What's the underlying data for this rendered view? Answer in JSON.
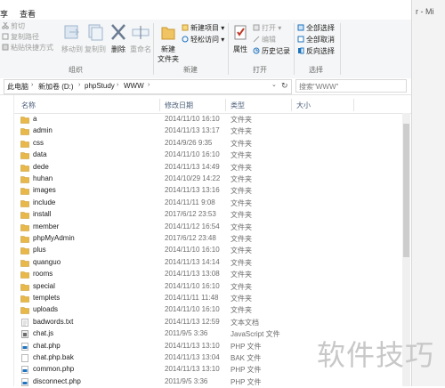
{
  "tabs": [
    "享",
    "查看"
  ],
  "window_fragment": "r - Mi",
  "ribbon": {
    "clipboard": {
      "label": "组织",
      "cut": "剪切",
      "copy_path": "复制路径",
      "paste_shortcut": "粘贴快捷方式"
    },
    "organize": {
      "move_to": "移动到",
      "copy_to": "复制到",
      "delete": "删除",
      "rename": "重命名"
    },
    "new": {
      "label": "新建",
      "new_item": "新建项目",
      "easy_access": "轻松访问",
      "new_folder": "新建\n文件夹",
      "new_folder_line1": "新建",
      "new_folder_line2": "文件夹"
    },
    "open": {
      "label": "打开",
      "properties": "属性",
      "open": "打开",
      "edit": "编辑",
      "history": "历史记录"
    },
    "select": {
      "label": "选择",
      "select_all": "全部选择",
      "select_none": "全部取消",
      "invert": "反向选择"
    }
  },
  "address": {
    "crumbs": [
      "此电脑",
      "新加卷 (D:)",
      "phpStudy",
      "WWW"
    ],
    "search_placeholder": "搜索\"WWW\""
  },
  "columns": {
    "name": "名称",
    "date": "修改日期",
    "type": "类型",
    "size": "大小"
  },
  "files": [
    {
      "name": "a",
      "date": "2014/11/10 16:10",
      "type": "文件夹",
      "icon": "folder"
    },
    {
      "name": "admin",
      "date": "2014/11/13 13:17",
      "type": "文件夹",
      "icon": "folder"
    },
    {
      "name": "css",
      "date": "2014/9/26 9:35",
      "type": "文件夹",
      "icon": "folder"
    },
    {
      "name": "data",
      "date": "2014/11/10 16:10",
      "type": "文件夹",
      "icon": "folder"
    },
    {
      "name": "dede",
      "date": "2014/11/13 14:49",
      "type": "文件夹",
      "icon": "folder"
    },
    {
      "name": "huhan",
      "date": "2014/10/29 14:22",
      "type": "文件夹",
      "icon": "folder"
    },
    {
      "name": "images",
      "date": "2014/11/13 13:16",
      "type": "文件夹",
      "icon": "folder"
    },
    {
      "name": "include",
      "date": "2014/11/11 9:08",
      "type": "文件夹",
      "icon": "folder"
    },
    {
      "name": "install",
      "date": "2017/6/12 23:53",
      "type": "文件夹",
      "icon": "folder"
    },
    {
      "name": "member",
      "date": "2014/11/12 16:54",
      "type": "文件夹",
      "icon": "folder"
    },
    {
      "name": "phpMyAdmin",
      "date": "2017/6/12 23:48",
      "type": "文件夹",
      "icon": "folder"
    },
    {
      "name": "plus",
      "date": "2014/11/10 16:10",
      "type": "文件夹",
      "icon": "folder"
    },
    {
      "name": "quanguo",
      "date": "2014/11/13 14:14",
      "type": "文件夹",
      "icon": "folder"
    },
    {
      "name": "rooms",
      "date": "2014/11/13 13:08",
      "type": "文件夹",
      "icon": "folder"
    },
    {
      "name": "special",
      "date": "2014/11/10 16:10",
      "type": "文件夹",
      "icon": "folder"
    },
    {
      "name": "templets",
      "date": "2014/11/11 11:48",
      "type": "文件夹",
      "icon": "folder"
    },
    {
      "name": "uploads",
      "date": "2014/11/10 16:10",
      "type": "文件夹",
      "icon": "folder"
    },
    {
      "name": "badwords.txt",
      "date": "2014/11/13 12:59",
      "type": "文本文档",
      "icon": "text"
    },
    {
      "name": "chat.js",
      "date": "2011/9/5 3:36",
      "type": "JavaScript 文件",
      "icon": "script"
    },
    {
      "name": "chat.php",
      "date": "2014/11/13 13:10",
      "type": "PHP 文件",
      "icon": "php"
    },
    {
      "name": "chat.php.bak",
      "date": "2014/11/13 13:04",
      "type": "BAK 文件",
      "icon": "file"
    },
    {
      "name": "common.php",
      "date": "2014/11/13 13:10",
      "type": "PHP 文件",
      "icon": "php"
    },
    {
      "name": "disconnect.php",
      "date": "2011/9/5 3:36",
      "type": "PHP 文件",
      "icon": "php"
    }
  ],
  "watermark": "软件技巧",
  "colors": {
    "folder": "#e8b84a",
    "accent": "#1e73be"
  }
}
